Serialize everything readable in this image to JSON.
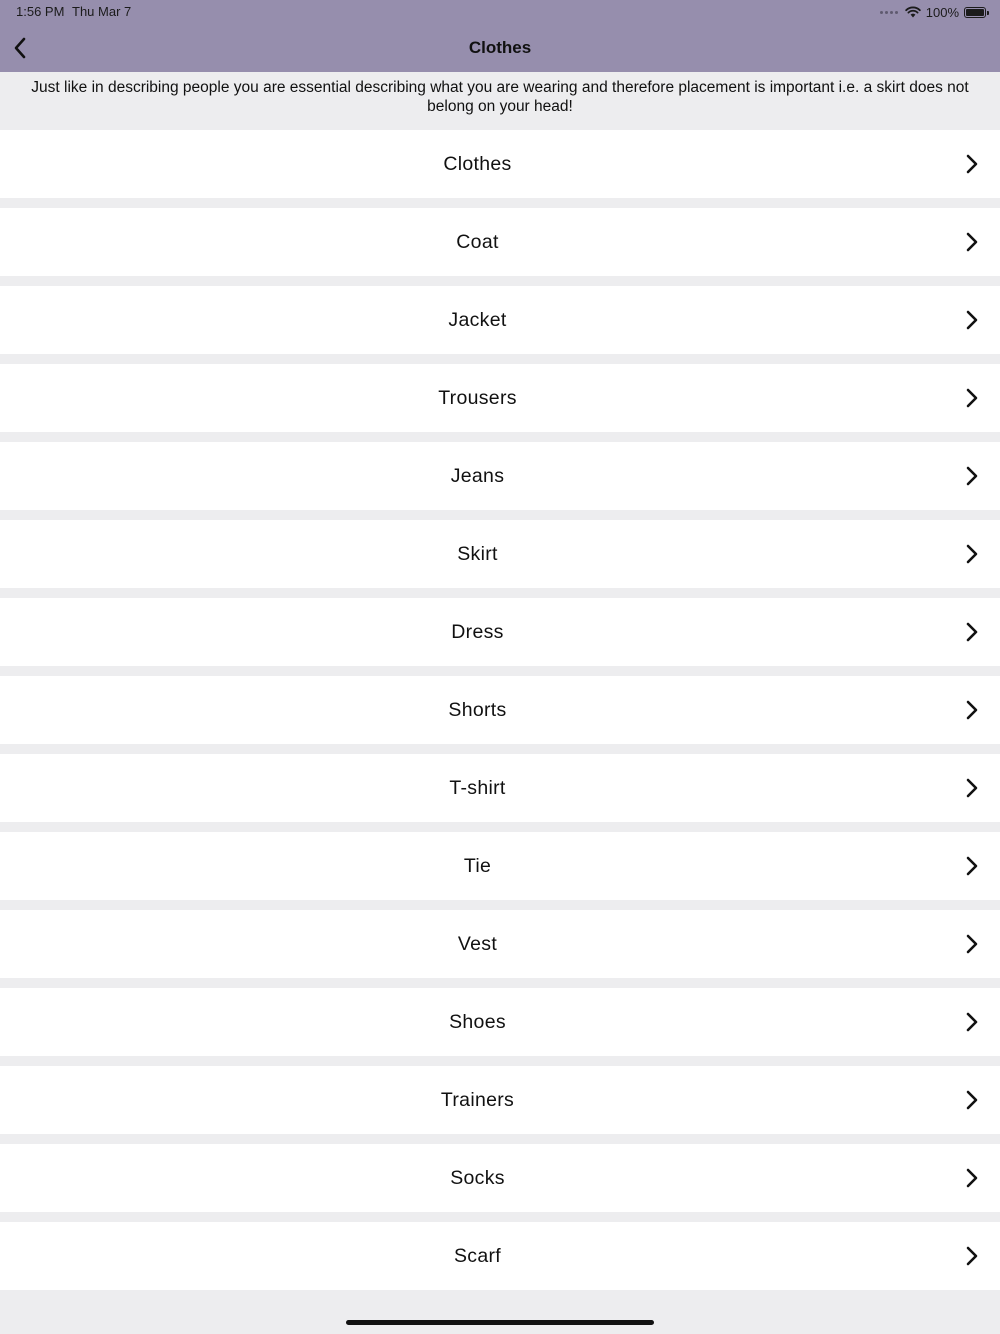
{
  "status_bar": {
    "time": "1:56 PM",
    "date": "Thu Mar 7",
    "battery": "100%",
    "battery_level": 1.0
  },
  "nav": {
    "title": "Clothes",
    "back_icon": "chevron-left-icon"
  },
  "description": "Just like in describing people you are essential describing what you are wearing and therefore placement is important i.e. a skirt does not belong on your head!",
  "items": [
    {
      "label": "Clothes"
    },
    {
      "label": "Coat"
    },
    {
      "label": "Jacket"
    },
    {
      "label": "Trousers"
    },
    {
      "label": "Jeans"
    },
    {
      "label": "Skirt"
    },
    {
      "label": "Dress"
    },
    {
      "label": "Shorts"
    },
    {
      "label": "T-shirt"
    },
    {
      "label": "Tie"
    },
    {
      "label": "Vest"
    },
    {
      "label": "Shoes"
    },
    {
      "label": "Trainers"
    },
    {
      "label": "Socks"
    },
    {
      "label": "Scarf"
    }
  ],
  "colors": {
    "nav_background": "#968ead",
    "page_background": "#ededef",
    "row_background": "#ffffff",
    "text": "#111111"
  }
}
